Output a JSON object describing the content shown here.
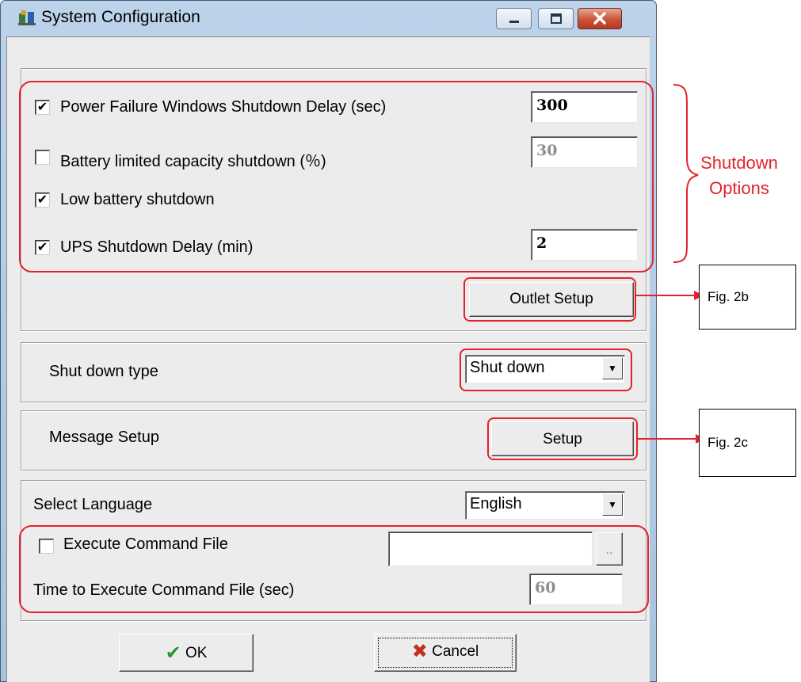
{
  "window": {
    "title": "System Configuration"
  },
  "shutdown_options": {
    "power_failure": {
      "label": "Power Failure Windows Shutdown Delay (sec)",
      "checked": true,
      "value": "300"
    },
    "battery_limited": {
      "label": "Battery limited  capacity shutdown (％)",
      "checked": false,
      "value": "30"
    },
    "low_battery": {
      "label": "Low battery shutdown",
      "checked": true
    },
    "ups_delay": {
      "label": "UPS Shutdown Delay (min)",
      "checked": true,
      "value": "2"
    },
    "outlet_button": "Outlet Setup"
  },
  "shutdown_type": {
    "label": "Shut down type",
    "value": "Shut down"
  },
  "message_setup": {
    "label": "Message Setup",
    "button": "Setup"
  },
  "language": {
    "label": "Select Language",
    "value": "English"
  },
  "command_file": {
    "label": "Execute Command File",
    "checked": false,
    "path": "",
    "browse": "..",
    "time_label": "Time to Execute Command File (sec)",
    "time_value": "60"
  },
  "footer": {
    "ok": "OK",
    "cancel": "Cancel"
  },
  "annotations": {
    "shutdown_options_line1": "Shutdown",
    "shutdown_options_line2": "Options",
    "fig_2b": "Fig. 2b",
    "fig_2c": "Fig. 2c"
  },
  "colors": {
    "annotation": "#e3222b",
    "ok_check": "#2e9a2e",
    "cancel_x": "#c0301e"
  },
  "icons": {
    "check": "✔",
    "cross": "✖",
    "dropdown": "▼"
  }
}
